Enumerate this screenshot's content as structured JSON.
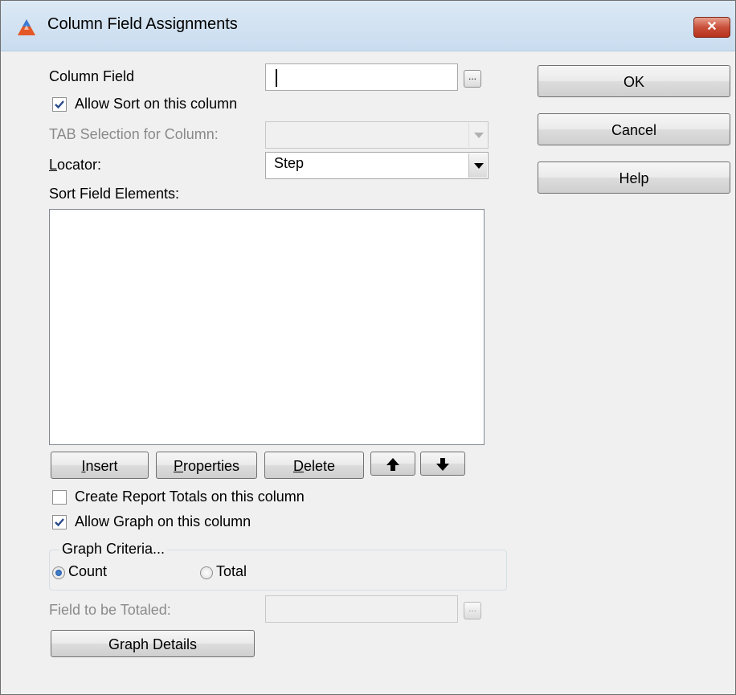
{
  "window": {
    "title": "Column Field Assignments",
    "close_label": "✕"
  },
  "column_field": {
    "label": "Column Field",
    "value": "",
    "browse_label": "..."
  },
  "allow_sort": {
    "label": "Allow Sort on this column",
    "checked": true
  },
  "tab_selection": {
    "label": "TAB Selection for Column:",
    "value": ""
  },
  "locator": {
    "label_underlined": "L",
    "label_rest": "ocator:",
    "value": "Step"
  },
  "sort_field_elements": {
    "label": "Sort Field Elements:",
    "items": []
  },
  "list_buttons": {
    "insert": {
      "ul": "I",
      "rest": "nsert"
    },
    "properties": {
      "ul": "P",
      "rest": "roperties"
    },
    "delete": {
      "ul": "D",
      "rest": "elete"
    }
  },
  "create_totals": {
    "label": "Create Report Totals on this column",
    "checked": false
  },
  "allow_graph": {
    "label": "Allow Graph on this column",
    "checked": true
  },
  "graph_criteria": {
    "title": "Graph Criteria...",
    "count_label": "Count",
    "total_label": "Total",
    "selected": "Count"
  },
  "field_to_total": {
    "label": "Field to be Totaled:",
    "value": "",
    "browse_label": "..."
  },
  "graph_details_label": "Graph Details",
  "side_buttons": {
    "ok": "OK",
    "cancel": "Cancel",
    "help": "Help"
  }
}
